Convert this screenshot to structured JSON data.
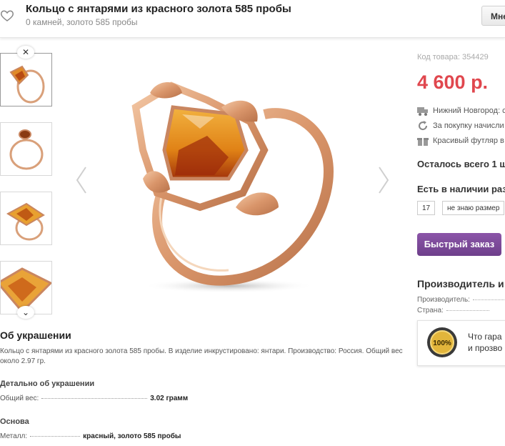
{
  "header": {
    "title": "Кольцо с янтарями из красного золота 585 пробы",
    "subtitle": "0 камней, золото 585 пробы",
    "right_button": "Мне"
  },
  "colors": {
    "price": "#e0474e",
    "order_button": "#7a4798",
    "gold": "#d9a07a",
    "amber": "#e38a1a"
  },
  "gallery": {
    "thumbnail_count": 4,
    "active_thumbnail": 1
  },
  "product": {
    "sku": "Код товара: 354429",
    "price": "4 600 р.",
    "delivery": "Нижний Новгород: с",
    "bonus": "За покупку начисли",
    "gift": "Красивый футляр в",
    "stock_left": "Осталось всего 1 ш",
    "available": "Есть в наличии раз",
    "sizes": [
      "17",
      "не знаю размер"
    ],
    "order_button": "Быстрый заказ"
  },
  "manufacturer": {
    "title": "Производитель и",
    "producer_label": "Производитель:",
    "country_label": "Страна:"
  },
  "guarantee": {
    "line1": "Что гара",
    "line2": "и прозво",
    "badge_text": "100%"
  },
  "about": {
    "title": "Об украшении",
    "description": "Кольцо с янтарями из красного золота 585 пробы. В изделие инкрустировано: янтари. Производство: Россия. Общий вес около 2.97 гр.",
    "details_title": "Детально об украшении",
    "weight_label": "Общий вес:",
    "weight_value": "3.02 грамм",
    "base_title": "Основа",
    "metal_label": "Металл:",
    "metal_value": "красный, золото 585 пробы"
  },
  "icons": {
    "favorite": "heart-outline-icon",
    "prev": "chevron-left-icon",
    "next": "chevron-right-icon",
    "scroll_up": "close-icon",
    "scroll_down": "chevron-down-icon",
    "delivery": "truck-icon",
    "bonus": "refresh-icon",
    "gift": "gift-icon"
  }
}
